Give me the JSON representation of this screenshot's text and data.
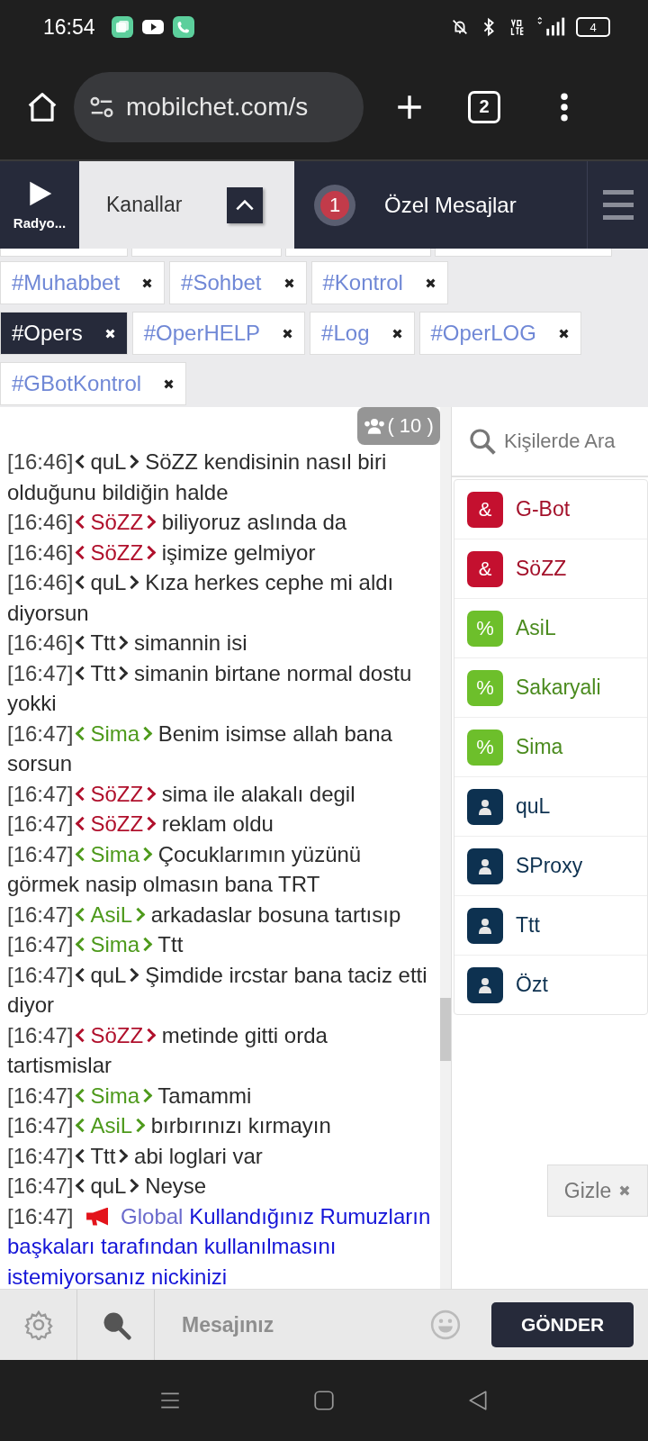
{
  "status_bar": {
    "time": "16:54",
    "battery": "4"
  },
  "browser": {
    "url": "mobilchet.com/s",
    "tab_count": "2"
  },
  "header": {
    "radio": {
      "label": "Radyo...",
      "playing": false
    },
    "tabs": [
      {
        "kind": "channels",
        "label": "Kanallar",
        "selected": true
      },
      {
        "kind": "private",
        "label": "Özel Mesajlar",
        "count": "1",
        "selected": false
      }
    ]
  },
  "channels": [
    {
      "name": "#Muhabbet",
      "selected": false
    },
    {
      "name": "#Sohbet",
      "selected": false
    },
    {
      "name": "#Kontrol",
      "selected": false
    },
    {
      "name": "#Opers",
      "selected": true
    },
    {
      "name": "#OperHELP",
      "selected": false
    },
    {
      "name": "#Log",
      "selected": false
    },
    {
      "name": "#OperLOG",
      "selected": false
    },
    {
      "name": "#GBotKontrol",
      "selected": false
    }
  ],
  "member_count": "( 10 )",
  "messages": [
    {
      "kind": "user",
      "time": "[16:46]",
      "nick": "quL",
      "text": "SöZZ kendisinin nasıl biri olduğunu bildiğin halde"
    },
    {
      "kind": "owner",
      "time": "[16:46]",
      "nick": "SöZZ",
      "text": "biliyoruz aslında da"
    },
    {
      "kind": "owner",
      "time": "[16:46]",
      "nick": "SöZZ",
      "text": "işimize gelmiyor"
    },
    {
      "kind": "user",
      "time": "[16:46]",
      "nick": "quL",
      "text": "Kıza herkes cephe mi aldı diyorsun"
    },
    {
      "kind": "user",
      "time": "[16:46]",
      "nick": "Ttt",
      "text": "simannin isi"
    },
    {
      "kind": "user",
      "time": "[16:47]",
      "nick": "Ttt",
      "text": "simanin birtane normal dostu yokki"
    },
    {
      "kind": "op",
      "time": "[16:47]",
      "nick": "Sima",
      "text": "Benim isimse allah bana sorsun"
    },
    {
      "kind": "owner",
      "time": "[16:47]",
      "nick": "SöZZ",
      "text": "sima ile alakalı degil"
    },
    {
      "kind": "owner",
      "time": "[16:47]",
      "nick": "SöZZ",
      "text": "reklam oldu"
    },
    {
      "kind": "op",
      "time": "[16:47]",
      "nick": "Sima",
      "text": "Çocuklarımın yüzünü görmek nasip olmasın bana TRT"
    },
    {
      "kind": "op",
      "time": "[16:47]",
      "nick": "AsiL",
      "text": "arkadaslar bosuna tartısıp"
    },
    {
      "kind": "op",
      "time": "[16:47]",
      "nick": "Sima",
      "text": "Ttt"
    },
    {
      "kind": "user",
      "time": "[16:47]",
      "nick": "quL",
      "text": "Şimdide ircstar bana taciz etti diyor"
    },
    {
      "kind": "owner",
      "time": "[16:47]",
      "nick": "SöZZ",
      "text": "metinde gitti orda tartismislar"
    },
    {
      "kind": "op",
      "time": "[16:47]",
      "nick": "Sima",
      "text": "Tamammi"
    },
    {
      "kind": "op",
      "time": "[16:47]",
      "nick": "AsiL",
      "text": "bırbırınızı kırmayın"
    },
    {
      "kind": "user",
      "time": "[16:47]",
      "nick": "Ttt",
      "text": "abi loglari var"
    },
    {
      "kind": "user",
      "time": "[16:47]",
      "nick": "quL",
      "text": "Neyse"
    },
    {
      "kind": "global",
      "time": "[16:47]",
      "label": "Global",
      "text": "Kullandığınız Rumuzların başkaları tarafından kullanılmasını istemiyorsanız nickinizi"
    }
  ],
  "users_panel": {
    "search_placeholder": "Kişilerde Ara",
    "users": [
      {
        "name": "G-Bot",
        "kind": "owner",
        "prefix": "&"
      },
      {
        "name": "SöZZ",
        "kind": "owner",
        "prefix": "&"
      },
      {
        "name": "AsiL",
        "kind": "op",
        "prefix": "%"
      },
      {
        "name": "Sakaryali",
        "kind": "op",
        "prefix": "%"
      },
      {
        "name": "Sima",
        "kind": "op",
        "prefix": "%"
      },
      {
        "name": "quL",
        "kind": "user"
      },
      {
        "name": "SProxy",
        "kind": "user"
      },
      {
        "name": "Ttt",
        "kind": "user"
      },
      {
        "name": "Özt",
        "kind": "user"
      }
    ],
    "hide_button": "Gizle"
  },
  "composer": {
    "placeholder": "Mesajınız",
    "send": "GÖNDER"
  }
}
